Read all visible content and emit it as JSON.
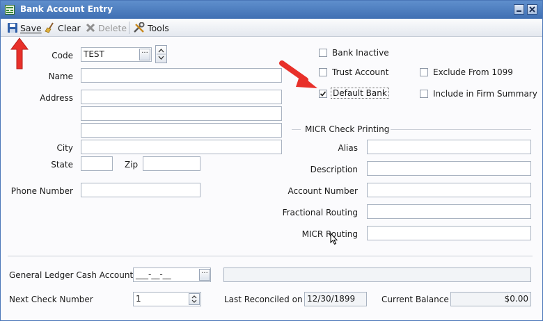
{
  "window": {
    "title": "Bank Account Entry"
  },
  "toolbar": {
    "save": "Save",
    "clear": "Clear",
    "delete": "Delete",
    "tools": "Tools"
  },
  "form": {
    "code_label": "Code",
    "code_value": "TEST",
    "name_label": "Name",
    "address_label": "Address",
    "city_label": "City",
    "state_label": "State",
    "zip_label": "Zip",
    "phone_label": "Phone Number"
  },
  "checkboxes": {
    "bank_inactive": {
      "label": "Bank Inactive",
      "checked": false
    },
    "trust_account": {
      "label": "Trust Account",
      "checked": false
    },
    "exclude_1099": {
      "label": "Exclude From 1099",
      "checked": false
    },
    "default_bank": {
      "label": "Default Bank",
      "checked": true
    },
    "firm_summary": {
      "label": "Include in Firm Summary",
      "checked": false
    }
  },
  "micr": {
    "section_title": "MICR Check Printing",
    "alias_label": "Alias",
    "description_label": "Description",
    "account_number_label": "Account Number",
    "fractional_routing_label": "Fractional Routing",
    "micr_routing_label": "MICR Routing"
  },
  "footer": {
    "gl_label": "General Ledger Cash Account",
    "gl_value": "___-__-__",
    "next_check_label": "Next Check Number",
    "next_check_value": "1",
    "last_reconciled_label": "Last Reconciled on",
    "last_reconciled_value": "12/30/1899",
    "current_balance_label": "Current Balance",
    "current_balance_value": "$0.00"
  },
  "colors": {
    "titlebar": "#4a7bbf",
    "annotation_arrow": "#e8302a"
  }
}
